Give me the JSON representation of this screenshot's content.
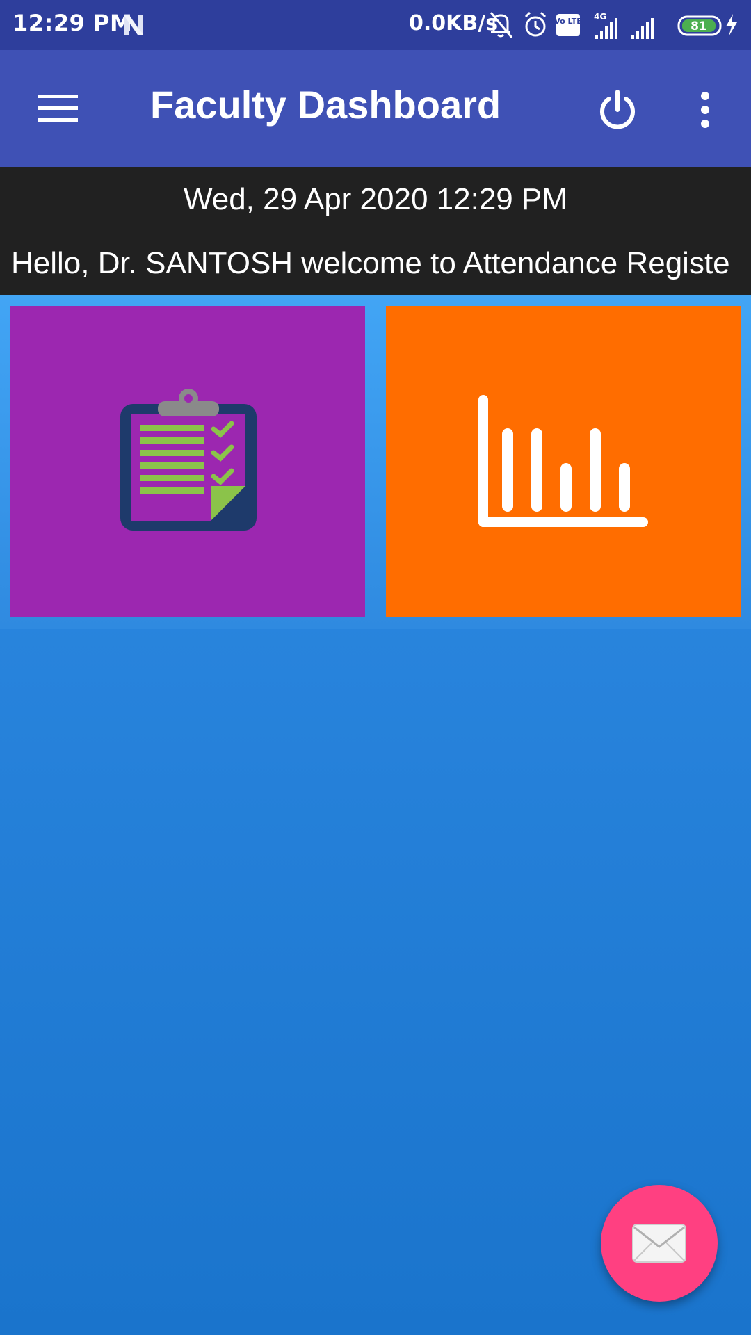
{
  "status_bar": {
    "time": "12:29 PM",
    "network_speed": "0.0KB/s",
    "network_type": "4G",
    "volte_label": "Vo LTE",
    "battery_level": "81",
    "icons": [
      "n-notification-icon",
      "mute-bell-icon",
      "alarm-icon",
      "volte-icon",
      "signal-icon",
      "signal-icon",
      "battery-icon",
      "charging-icon"
    ]
  },
  "app_bar": {
    "title": "Faculty Dashboard",
    "icons": [
      "menu-icon",
      "power-icon",
      "more-vertical-icon"
    ],
    "color": "#3f51b5"
  },
  "banner": {
    "date": "Wed, 29 Apr 2020 12:29 PM",
    "welcome": "Hello, Dr. SANTOSH welcome to Attendance Registe"
  },
  "tiles": [
    {
      "icon": "clipboard-checklist-icon",
      "color": "#9c27b0"
    },
    {
      "icon": "bar-chart-icon",
      "color": "#ff6d00"
    }
  ],
  "fab": {
    "icon": "mail-icon",
    "color": "#ff4081"
  }
}
